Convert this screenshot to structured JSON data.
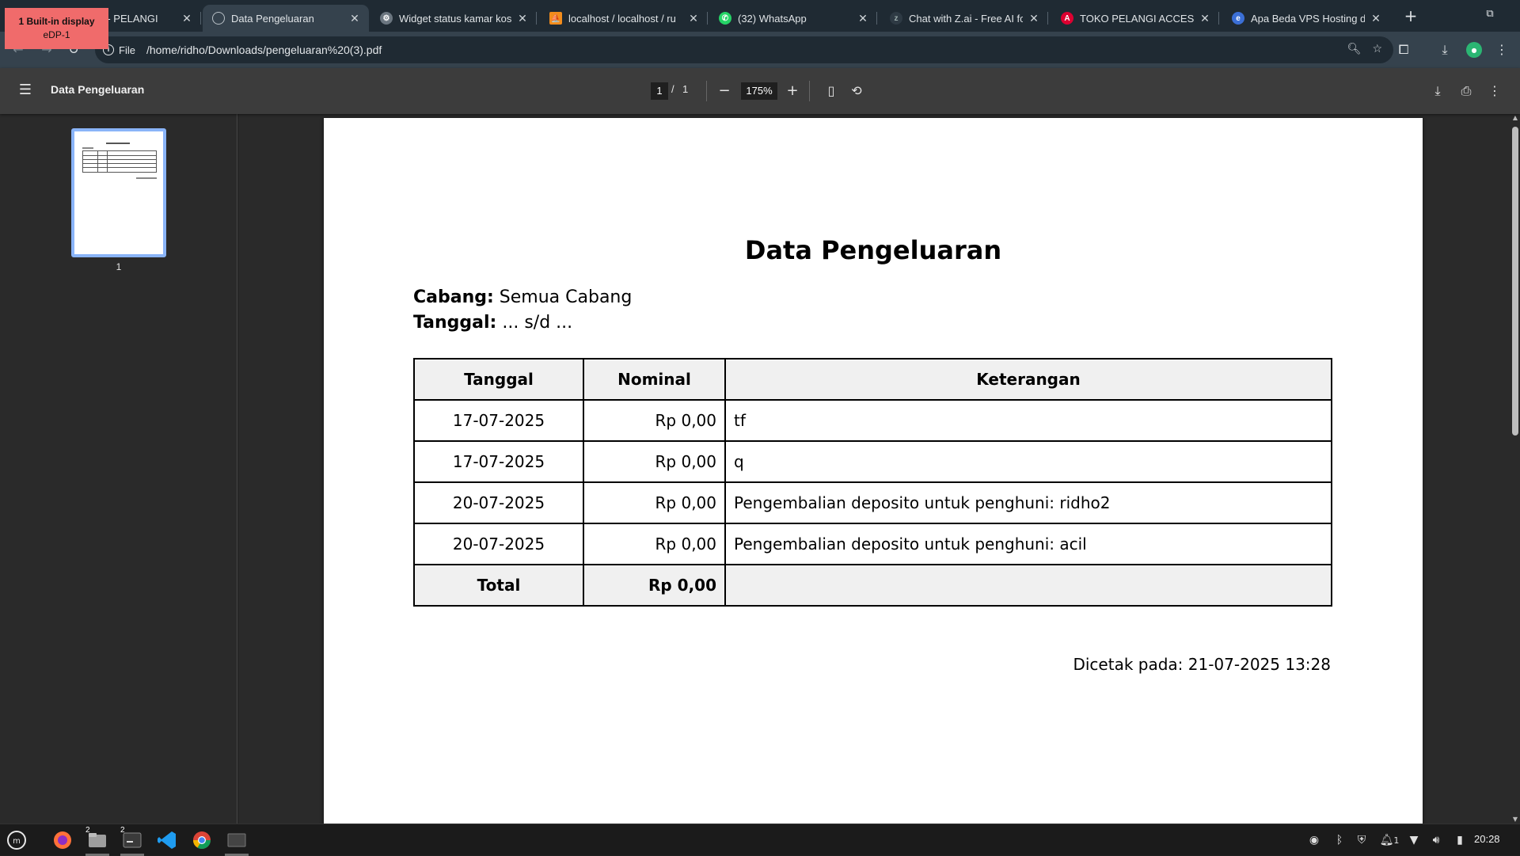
{
  "display_badge": {
    "title": "1  Built-in display",
    "subtitle": "eDP-1"
  },
  "tabs": [
    {
      "title": "ns - PELANGI",
      "favicon": "gear-icon",
      "active": false
    },
    {
      "title": "Data Pengeluaran",
      "favicon": "globe-icon",
      "active": true
    },
    {
      "title": "Widget status kamar kos",
      "favicon": "gear-icon",
      "active": false
    },
    {
      "title": "localhost / localhost / ru",
      "favicon": "phpmyadmin-icon",
      "active": false
    },
    {
      "title": "(32) WhatsApp",
      "favicon": "whatsapp-icon",
      "active": false
    },
    {
      "title": "Chat with Z.ai - Free AI fo",
      "favicon": "zai-icon",
      "active": false
    },
    {
      "title": "TOKO PELANGI ACCESO",
      "favicon": "angular-icon",
      "active": false
    },
    {
      "title": "Apa Beda VPS Hosting d",
      "favicon": "e-icon",
      "active": false
    }
  ],
  "omnibox": {
    "site_label": "File",
    "url": "/home/ridho/Downloads/pengeluaran%20(3).pdf"
  },
  "pdf_toolbar": {
    "title": "Data Pengeluaran",
    "current_page": "1",
    "separator": "/",
    "total_pages": "1",
    "zoom": "175%"
  },
  "sidebar": {
    "thumbnail_label": "1"
  },
  "document": {
    "title": "Data Pengeluaran",
    "branch_label": "Cabang:",
    "branch_value": "Semua Cabang",
    "date_label": "Tanggal:",
    "date_value": "... s/d ...",
    "table": {
      "headers": [
        "Tanggal",
        "Nominal",
        "Keterangan"
      ],
      "rows": [
        [
          "17-07-2025",
          "Rp 0,00",
          "tf"
        ],
        [
          "17-07-2025",
          "Rp 0,00",
          "q"
        ],
        [
          "20-07-2025",
          "Rp 0,00",
          "Pengembalian deposito untuk penghuni: ridho2"
        ],
        [
          "20-07-2025",
          "Rp 0,00",
          "Pengembalian deposito untuk penghuni: acil"
        ]
      ],
      "total_label": "Total",
      "total_value": "Rp 0,00"
    },
    "printed_at": "Dicetak pada: 21-07-2025 13:28"
  },
  "taskbar": {
    "items": [
      {
        "name": "mint-menu-icon",
        "count": ""
      },
      {
        "name": "firefox-icon",
        "count": ""
      },
      {
        "name": "files-icon",
        "count": "2"
      },
      {
        "name": "terminal-icon",
        "count": "2"
      },
      {
        "name": "vscode-icon",
        "count": ""
      },
      {
        "name": "chrome-icon",
        "count": ""
      },
      {
        "name": "window-icon",
        "count": ""
      }
    ],
    "tray_count": "1",
    "clock": "20:28"
  },
  "colors": {
    "tab_strip": "#1f2a33",
    "toolbar": "#35424d",
    "pdf_toolbar": "#3c3c3c",
    "viewer_bg": "#2a2a2a",
    "thumbnail_border": "#8ab4f8",
    "badge": "#f06b6b",
    "table_header_bg": "#f0f0f0"
  }
}
